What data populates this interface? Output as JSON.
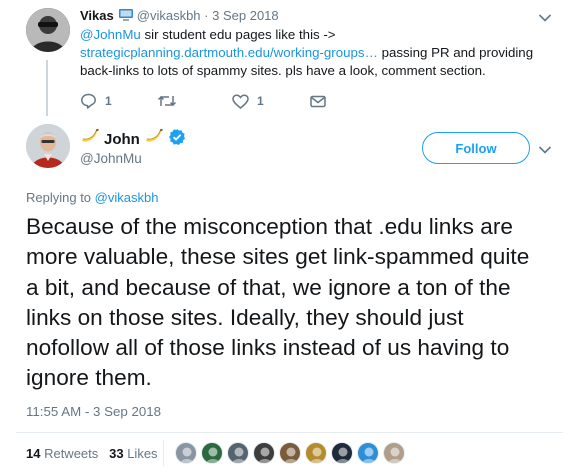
{
  "reply": {
    "name": "Vikas",
    "handle": "@vikaskbh",
    "separator": "·",
    "date": "3 Sep 2018",
    "text_mention": "@JohnMu",
    "text_part1": " sir student edu pages like this ->",
    "text_link": "strategicplanning.dartmouth.edu/working-groups…",
    "text_part2": " passing PR and providing back-links to lots of spammy sites. pls have a look, comment section.",
    "reply_count": "1",
    "retweet_count": "",
    "like_count": "1"
  },
  "tweet": {
    "name": "John",
    "handle": "@JohnMu",
    "follow_label": "Follow",
    "replying_prefix": "Replying to ",
    "replying_to": "@vikaskbh",
    "text": "Because of the misconception that .edu links are more valuable, these sites get link-spammed quite a bit, and because of that, we ignore a ton of the links on those sites. Ideally, they should just nofollow all of those links instead of us having to ignore them.",
    "timestamp": "11:55 AM - 3 Sep 2018",
    "retweets_count": "14",
    "retweets_label": " Retweets",
    "likes_count": "33",
    "likes_label": " Likes"
  },
  "icons": {
    "verified": "verified-badge-icon",
    "banana": "banana-emoji-icon",
    "computer": "computer-emoji-icon"
  },
  "colors": {
    "link": "#1b95e0",
    "brand": "#1da1f2",
    "muted": "#657786",
    "text": "#14171a"
  },
  "likers": [
    {
      "name": "liker-1",
      "color": "#8a95a3"
    },
    {
      "name": "liker-2",
      "color": "#2b6a3f"
    },
    {
      "name": "liker-3",
      "color": "#556270"
    },
    {
      "name": "liker-4",
      "color": "#3d3d3d"
    },
    {
      "name": "liker-5",
      "color": "#7a5b3a"
    },
    {
      "name": "liker-6",
      "color": "#b68b2c"
    },
    {
      "name": "liker-7",
      "color": "#1f2a3a"
    },
    {
      "name": "liker-8",
      "color": "#2d8fd8"
    },
    {
      "name": "liker-9",
      "color": "#b09e8a"
    }
  ]
}
